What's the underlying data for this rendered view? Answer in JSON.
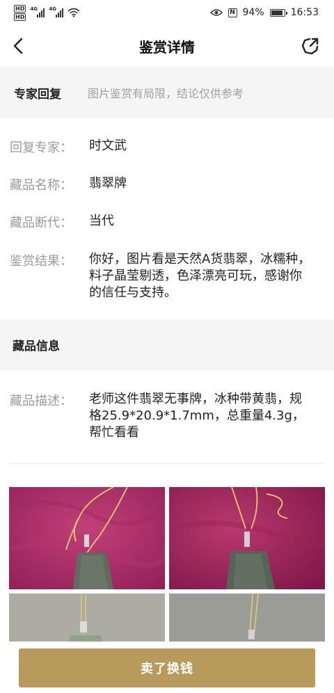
{
  "status_bar": {
    "hd1": "HD",
    "hd2": "HD",
    "net1": "4G",
    "net2": "4G",
    "battery": "94%",
    "time": "16:53",
    "icons": [
      "eye-icon",
      "nfc-icon",
      "battery-icon",
      "wifi-icon",
      "signal-icon"
    ]
  },
  "nav": {
    "title": "鉴赏详情",
    "back_icon": "chevron-left-icon",
    "share_icon": "share-icon"
  },
  "expert_reply": {
    "header": "专家回复",
    "note": "图片鉴赏有局限，结论仅供参考",
    "fields": [
      {
        "label": "回复专家：",
        "value": "时文武"
      },
      {
        "label": "藏品名称：",
        "value": "翡翠牌"
      },
      {
        "label": "藏品断代：",
        "value": "当代"
      },
      {
        "label": "鉴赏结果：",
        "value": "你好，图片看是天然A货翡翠，冰糯种，料子晶莹剔透，色泽漂亮可玩，感谢你的信任与支持。"
      }
    ]
  },
  "item_info": {
    "header": "藏品信息",
    "description_label": "藏品描述：",
    "description": "老师这件翡翠无事牌，冰种带黄翡，规格25.9*20.9*1.7mm，总重量4.3g，帮忙看看"
  },
  "photos": [
    "jade-pendant-photo-1",
    "jade-pendant-photo-2",
    "jade-pendant-photo-3",
    "jade-pendant-photo-4"
  ],
  "colors": {
    "accent": "#b89a5c",
    "section_bg": "#f5f5f5",
    "label": "#9a9a9a"
  },
  "actions": {
    "sell_label": "卖了换钱"
  }
}
